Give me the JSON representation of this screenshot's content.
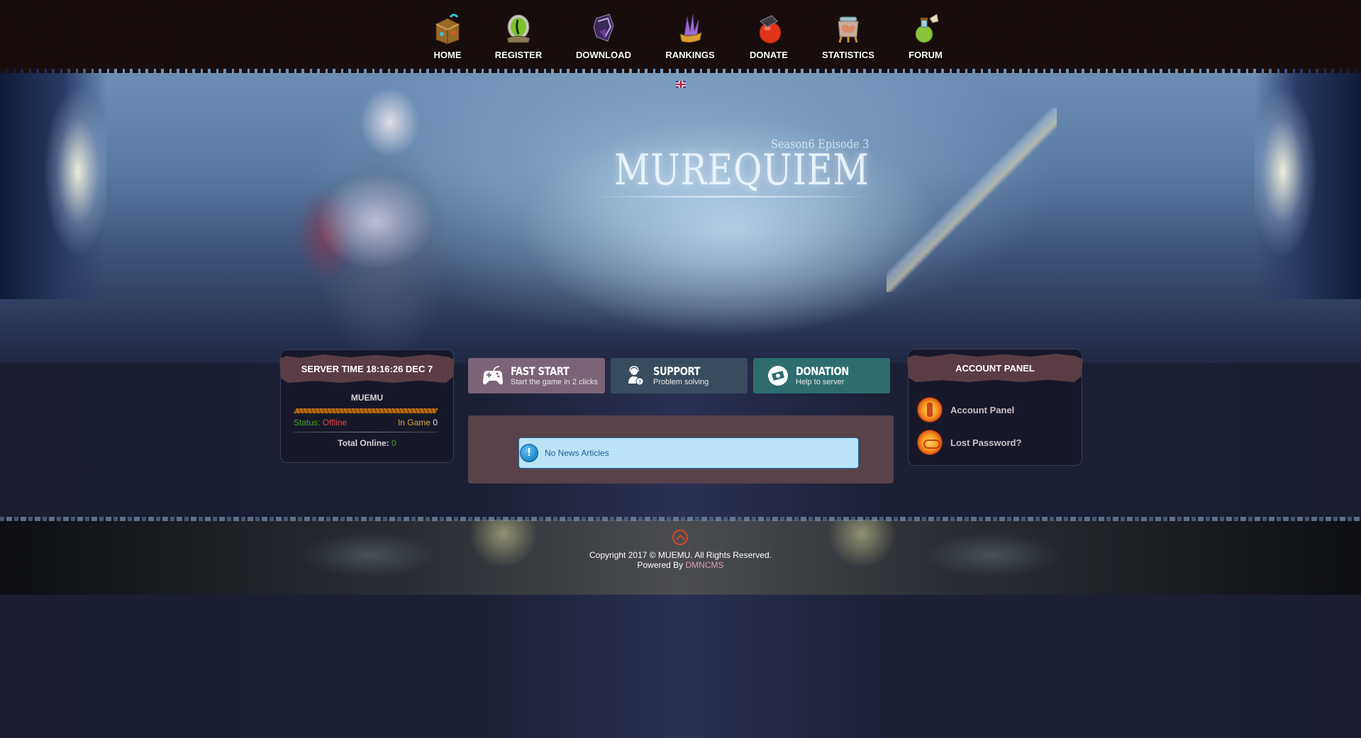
{
  "nav": {
    "items": [
      {
        "label": "HOME",
        "icon": "treasure-chest-icon",
        "color": "#b5803a"
      },
      {
        "label": "REGISTER",
        "icon": "eye-orb-icon",
        "color": "#7cc42a"
      },
      {
        "label": "DOWNLOAD",
        "icon": "dark-crystal-icon",
        "color": "#5a4a8a"
      },
      {
        "label": "RANKINGS",
        "icon": "crystal-crown-icon",
        "color": "#9a6ad0"
      },
      {
        "label": "DONATE",
        "icon": "red-potion-icon",
        "color": "#e0341a"
      },
      {
        "label": "STATISTICS",
        "icon": "brain-jar-icon",
        "color": "#d8956a"
      },
      {
        "label": "FORUM",
        "icon": "green-potion-icon",
        "color": "#8ac43a"
      }
    ]
  },
  "header": {
    "logo": "MUREQUIEM",
    "subtitle": "Season6 Episode 3",
    "language": "English"
  },
  "server_panel": {
    "title": "SERVER TIME 18:16:26 DEC 7",
    "server_name": "MUEMU",
    "load_fraction": 1.0,
    "status_label": "Status:",
    "status_value": "Offline",
    "in_game_label": "In Game",
    "in_game_value": "0",
    "total_online_label": "Total Online:",
    "total_online_value": "0"
  },
  "quick_buttons": [
    {
      "title": "FAST START",
      "subtitle": "Start the game in 2 clicks",
      "icon": "gamepad-icon",
      "color": "#7b6478"
    },
    {
      "title": "SUPPORT",
      "subtitle": "Problem solving",
      "icon": "support-agent-icon",
      "color": "#394c5e"
    },
    {
      "title": "DONATION",
      "subtitle": "Help to server",
      "icon": "money-icon",
      "color": "#2d6d6d"
    }
  ],
  "news": {
    "message": "No News Articles",
    "icon": "info-exclamation-icon"
  },
  "account_panel": {
    "title": "ACCOUNT PANEL",
    "items": [
      {
        "label": "Account Panel",
        "icon": "key-icon"
      },
      {
        "label": "Lost Password?",
        "icon": "horn-icon"
      }
    ]
  },
  "footer": {
    "copyright": "Copyright 2017 © MUEMU. All Rights Reserved.",
    "powered_by_label": "Powered By",
    "powered_by_link": "DMNCMS"
  },
  "colors": {
    "status_ok": "#3fa323",
    "status_bad": "#d9464f",
    "gold": "#d8a948",
    "accent_orange": "#d9491f",
    "panel_header": "#5a3d45"
  }
}
